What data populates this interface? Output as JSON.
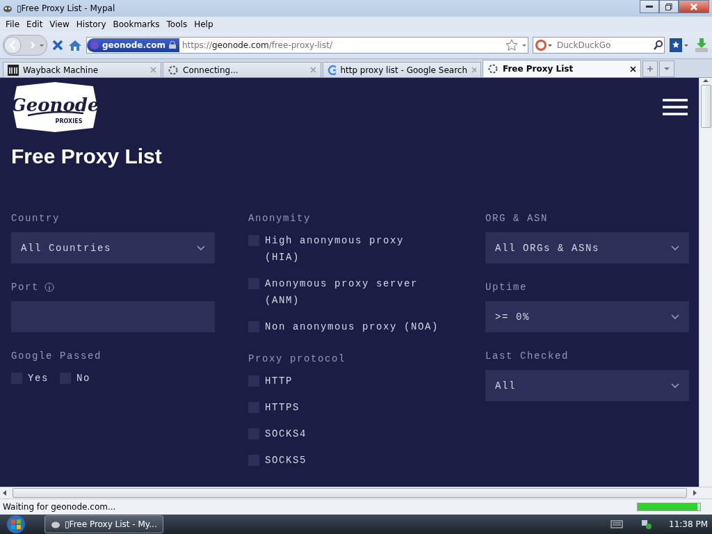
{
  "window": {
    "title": "▯Free Proxy List - Mypal"
  },
  "menu": [
    {
      "label": "File"
    },
    {
      "label": "Edit"
    },
    {
      "label": "View"
    },
    {
      "label": "History"
    },
    {
      "label": "Bookmarks"
    },
    {
      "label": "Tools"
    },
    {
      "label": "Help"
    }
  ],
  "address_bar": {
    "site_badge": "geonode.com",
    "scheme": "https://",
    "host": "geonode.com",
    "path": "/free-proxy-list/"
  },
  "search": {
    "placeholder": "DuckDuckGo"
  },
  "tabs": [
    {
      "label": "Wayback Machine",
      "selected": false,
      "kind": "archive"
    },
    {
      "label": "Connecting...",
      "selected": false,
      "kind": "loading"
    },
    {
      "label": "http proxy list - Google Search",
      "selected": false,
      "kind": "google"
    },
    {
      "label": "Free Proxy List",
      "selected": true,
      "kind": "loading"
    }
  ],
  "page": {
    "logo": {
      "text": "Geonode",
      "subtext": "PROXIES"
    },
    "heading": "Free Proxy List",
    "columns": [
      [
        {
          "kind": "select",
          "label": "Country",
          "value": "All Countries"
        },
        {
          "kind": "input",
          "label": "Port",
          "info": true
        },
        {
          "kind": "inline-checks",
          "label": "Google Passed",
          "options": [
            {
              "label": "Yes",
              "checked": false
            },
            {
              "label": "No",
              "checked": false
            }
          ]
        }
      ],
      [
        {
          "kind": "checks",
          "label": "Anonymity",
          "options": [
            {
              "label": "High anonymous proxy (HIA)",
              "checked": false
            },
            {
              "label": "Anonymous proxy server (ANM)",
              "checked": false
            },
            {
              "label": "Non anonymous proxy (NOA)",
              "checked": false
            }
          ]
        },
        {
          "kind": "checks",
          "label": "Proxy protocol",
          "options": [
            {
              "label": "HTTP",
              "checked": false
            },
            {
              "label": "HTTPS",
              "checked": false
            },
            {
              "label": "SOCKS4",
              "checked": false
            },
            {
              "label": "SOCKS5",
              "checked": false
            }
          ]
        }
      ],
      [
        {
          "kind": "select",
          "label": "ORG & ASN",
          "value": "All ORGs & ASNs"
        },
        {
          "kind": "select",
          "label": "Uptime",
          "value": ">= 0%"
        },
        {
          "kind": "select",
          "label": "Last Checked",
          "value": "All"
        }
      ]
    ]
  },
  "status_bar": {
    "text": "Waiting for geonode.com...",
    "level": 0.95
  },
  "taskbar": {
    "task": "▯Free Proxy List - My...",
    "clock": "11:38 PM"
  }
}
